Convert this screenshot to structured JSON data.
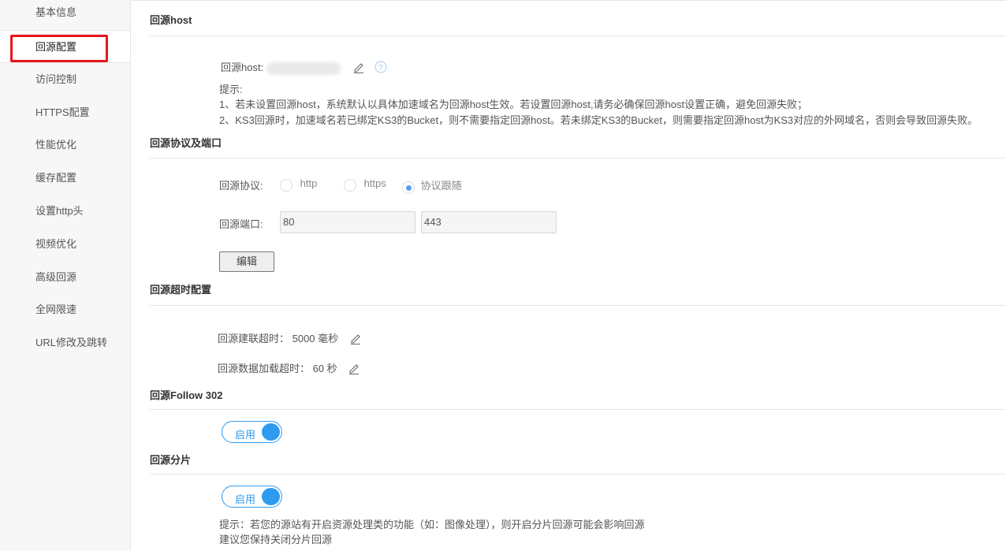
{
  "sidebar": {
    "items": [
      {
        "label": "基本信息"
      },
      {
        "label": "回源配置"
      },
      {
        "label": "访问控制"
      },
      {
        "label": "HTTPS配置"
      },
      {
        "label": "性能优化"
      },
      {
        "label": "缓存配置"
      },
      {
        "label": "设置http头"
      },
      {
        "label": "视频优化"
      },
      {
        "label": "高级回源"
      },
      {
        "label": "全网限速"
      },
      {
        "label": "URL修改及跳转"
      }
    ],
    "active_index": 1
  },
  "host": {
    "title": "回源host",
    "label": "回源host:",
    "tip_title": "提示:",
    "tip1": "1、若未设置回源host，系统默认以具体加速域名为回源host生效。若设置回源host,请务必确保回源host设置正确，避免回源失败；",
    "tip2": "2、KS3回源时，加速域名若已绑定KS3的Bucket，则不需要指定回源host。若未绑定KS3的Bucket，则需要指定回源host为KS3对应的外网域名，否则会导致回源失败。"
  },
  "protocol": {
    "title": "回源协议及端口",
    "protocol_label": "回源协议:",
    "options": [
      {
        "label": "http",
        "selected": false
      },
      {
        "label": "https",
        "selected": false
      },
      {
        "label": "协议跟随",
        "selected": true
      }
    ],
    "port_label": "回源端口:",
    "http_port": "80",
    "https_port": "443",
    "edit_label": "编辑"
  },
  "timeout": {
    "title": "回源超时配置",
    "connect": "回源建联超时： 5000 毫秒",
    "data": "回源数据加载超时： 60 秒"
  },
  "follow": {
    "title": "回源Follow 302",
    "toggle_label": "启用",
    "enabled": true
  },
  "range": {
    "title": "回源分片",
    "toggle_label": "启用",
    "enabled": true,
    "tip1": "提示：若您的源站有开启资源处理类的功能（如：图像处理），则开启分片回源可能会影响回源",
    "tip2": "建议您保持关闭分片回源"
  }
}
